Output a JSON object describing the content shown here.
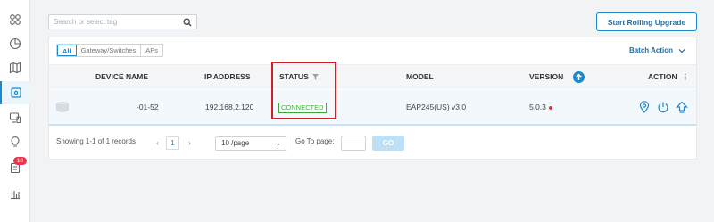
{
  "nav": {
    "notification_count": "10",
    "items": [
      {
        "icon": "dashboard-icon"
      },
      {
        "icon": "statistics-icon"
      },
      {
        "icon": "map-icon"
      },
      {
        "icon": "devices-icon"
      },
      {
        "icon": "clients-icon"
      },
      {
        "icon": "insight-icon"
      },
      {
        "icon": "logs-icon"
      },
      {
        "icon": "reports-icon"
      }
    ]
  },
  "search": {
    "placeholder": "Search or select tag"
  },
  "header": {
    "rolling_upgrade_label": "Start Rolling Upgrade"
  },
  "filters": {
    "tabs": [
      "All",
      "Gateway/Switches",
      "APs"
    ],
    "active": "All"
  },
  "batch_action_label": "Batch Action",
  "table": {
    "columns": {
      "device_name": "DEVICE NAME",
      "ip_address": "IP ADDRESS",
      "status": "STATUS",
      "model": "MODEL",
      "version": "VERSION",
      "action": "ACTION"
    },
    "rows": [
      {
        "device_name": "-01-52",
        "ip_address": "192.168.2.120",
        "status": "CONNECTED",
        "model": "EAP245(US) v3.0",
        "version": "5.0.3"
      }
    ]
  },
  "pagination": {
    "summary": "Showing 1-1 of 1 records",
    "current_page": "1",
    "per_page": "10 /page",
    "goto_label": "Go To page:",
    "go_label": "GO"
  },
  "colors": {
    "accent": "#1e88c8",
    "status_connected": "#3cab3f",
    "highlight_box": "#d21e26",
    "badge": "#e5384f"
  }
}
